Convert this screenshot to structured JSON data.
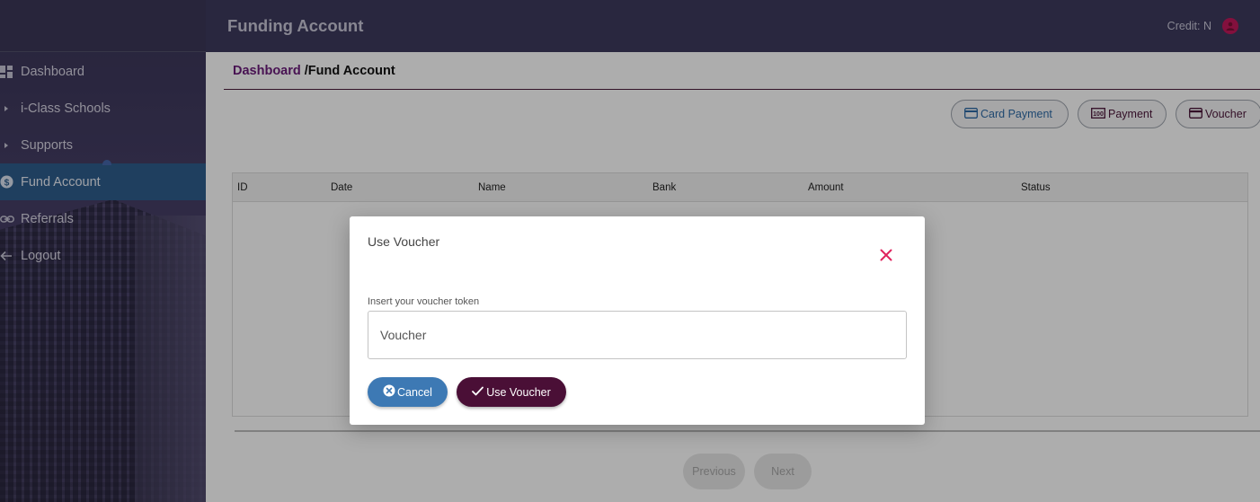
{
  "app": {
    "title": "Funding Account"
  },
  "topbar": {
    "credit_label": "Credit: N"
  },
  "sidebar": {
    "items": [
      {
        "label": "Dashboard",
        "icon": "dashboard-icon"
      },
      {
        "label": "i-Class Schools",
        "icon": "caret-right-icon"
      },
      {
        "label": "Supports",
        "icon": "caret-right-icon"
      },
      {
        "label": "Fund Account",
        "icon": "dollar-circle-icon",
        "active": true
      },
      {
        "label": "Referrals",
        "icon": "link-icon"
      },
      {
        "label": "Logout",
        "icon": "arrow-left-icon"
      }
    ]
  },
  "breadcrumb": {
    "root": "Dashboard",
    "separator": "/",
    "current": "Fund Account"
  },
  "actions": {
    "card_payment": "Card Payment",
    "payment": "Payment",
    "voucher": "Voucher"
  },
  "table": {
    "headers": [
      "ID",
      "Date",
      "Name",
      "Bank",
      "Amount",
      "Status"
    ]
  },
  "pager": {
    "previous": "Previous",
    "next": "Next"
  },
  "modal": {
    "title": "Use Voucher",
    "field_label": "Insert your voucher token",
    "field_placeholder": "Voucher",
    "field_value": "",
    "cancel_label": "Cancel",
    "submit_label": "Use Voucher"
  },
  "colors": {
    "topbar": "#3d3a5e",
    "sidebar_active": "#2f5d8c",
    "brand_dark": "#4a0f36",
    "cancel_blue": "#3d79b4",
    "close_red": "#e0245e"
  }
}
